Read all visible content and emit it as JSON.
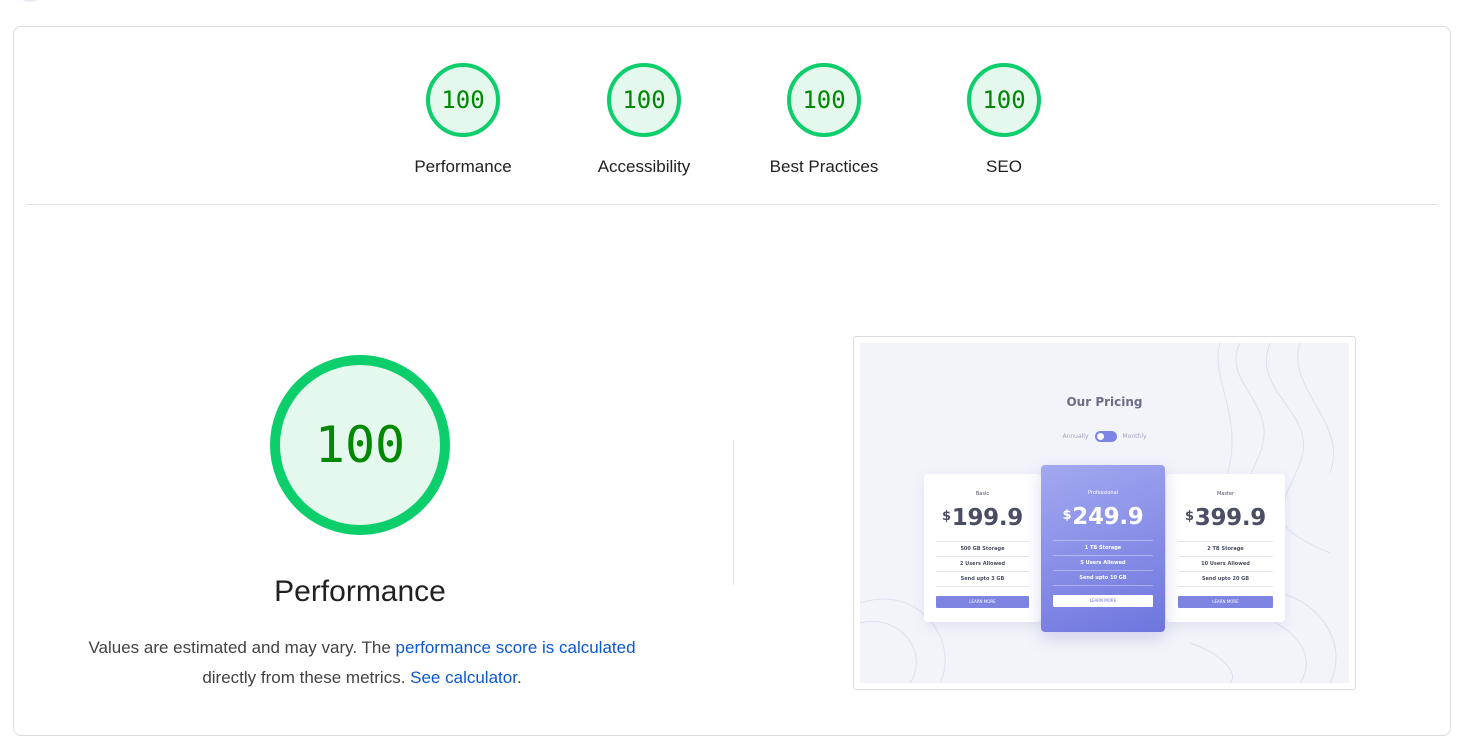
{
  "summary": {
    "gauges": [
      {
        "score": "100",
        "label": "Performance"
      },
      {
        "score": "100",
        "label": "Accessibility"
      },
      {
        "score": "100",
        "label": "Best Practices"
      },
      {
        "score": "100",
        "label": "SEO"
      }
    ]
  },
  "performance": {
    "score": "100",
    "title": "Performance",
    "desc_part1": "Values are estimated and may vary. The ",
    "desc_link1": "performance score is calculated",
    "desc_part2": "directly from these metrics. ",
    "desc_link2": "See calculator",
    "desc_part3": "."
  },
  "screenshot": {
    "heading": "Our Pricing",
    "toggle_left": "Annually",
    "toggle_right": "Monthly",
    "plans": [
      {
        "name": "Basic",
        "currency": "$",
        "price": "199.9",
        "features": [
          "500 GB Storage",
          "2 Users Allowed",
          "Send upto 3 GB"
        ],
        "button": "LEARN MORE"
      },
      {
        "name": "Professional",
        "currency": "$",
        "price": "249.9",
        "features": [
          "1 TB Storage",
          "5 Users Allowed",
          "Send upto 10 GB"
        ],
        "button": "LEARN MORE"
      },
      {
        "name": "Master",
        "currency": "$",
        "price": "399.9",
        "features": [
          "2 TB Storage",
          "10 Users Allowed",
          "Send upto 20 GB"
        ],
        "button": "LEARN MORE"
      }
    ]
  },
  "colors": {
    "pass_ring": "#0cce6b",
    "pass_fill": "#e5f8ee",
    "pass_text": "#008800",
    "link": "#0b57d0"
  }
}
